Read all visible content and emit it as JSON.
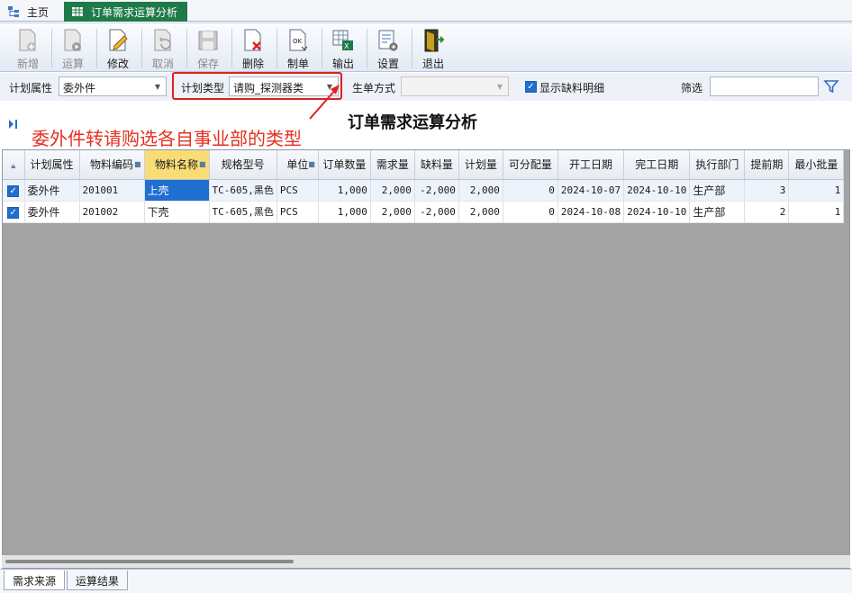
{
  "tabs": {
    "home": "主页",
    "active": "订单需求运算分析"
  },
  "toolbar": {
    "buttons": [
      {
        "label": "新增",
        "icon": "new-doc-icon",
        "enabled": false
      },
      {
        "label": "运算",
        "icon": "run-icon",
        "enabled": false
      },
      {
        "label": "修改",
        "icon": "edit-icon",
        "enabled": true
      },
      {
        "label": "取消",
        "icon": "undo-icon",
        "enabled": false
      },
      {
        "label": "保存",
        "icon": "save-icon",
        "enabled": false
      },
      {
        "label": "删除",
        "icon": "delete-icon",
        "enabled": true
      },
      {
        "label": "制单",
        "icon": "ok-doc-icon",
        "enabled": true
      },
      {
        "label": "输出",
        "icon": "excel-export-icon",
        "enabled": true
      },
      {
        "label": "设置",
        "icon": "settings-icon",
        "enabled": true
      },
      {
        "label": "退出",
        "icon": "exit-door-icon",
        "enabled": true
      }
    ]
  },
  "filters": {
    "plan_attr_label": "计划属性",
    "plan_attr_value": "委外件",
    "plan_type_label": "计划类型",
    "plan_type_value": "请购_探测器类",
    "gen_method_label": "生单方式",
    "gen_method_value": "",
    "show_shortage_label": "显示缺料明细",
    "show_shortage_checked": true,
    "filter_label": "筛选",
    "filter_value": ""
  },
  "annotation": "委外件转请购选各自事业部的类型",
  "page_title": "订单需求运算分析",
  "grid": {
    "columns": [
      "计划属性",
      "物料编码",
      "物料名称",
      "规格型号",
      "单位",
      "订单数量",
      "需求量",
      "缺料量",
      "计划量",
      "可分配量",
      "开工日期",
      "完工日期",
      "执行部门",
      "提前期",
      "最小批量"
    ],
    "rows": [
      {
        "checked": true,
        "cells": [
          "委外件",
          "201001",
          "上壳",
          "TC-605,黑色",
          "PCS",
          "1,000",
          "2,000",
          "-2,000",
          "2,000",
          "0",
          "2024-10-07",
          "2024-10-10",
          "生产部",
          "3",
          "1"
        ]
      },
      {
        "checked": true,
        "cells": [
          "委外件",
          "201002",
          "下壳",
          "TC-605,黑色",
          "PCS",
          "1,000",
          "2,000",
          "-2,000",
          "2,000",
          "0",
          "2024-10-08",
          "2024-10-10",
          "生产部",
          "2",
          "1"
        ]
      }
    ]
  },
  "bottom_tabs": [
    "需求来源",
    "运算结果"
  ],
  "colors": {
    "active_tab": "#1f7a4a",
    "annotation": "#e53020",
    "selection": "#1f6fd0",
    "highlight_header": "#f8dc75"
  }
}
